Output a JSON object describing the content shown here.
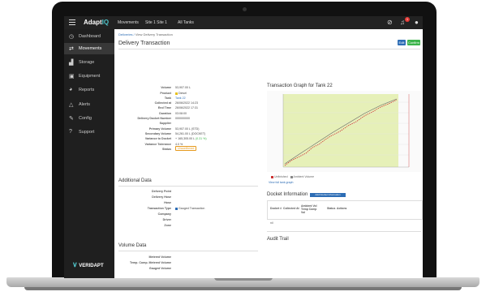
{
  "topbar": {
    "brand_main": "Adapt",
    "brand_accent": "IQ",
    "nav": [
      "Movements",
      "Site 1 Site 1",
      "All Tanks"
    ]
  },
  "sidebar": {
    "items": [
      {
        "label": "Dashboard",
        "icon": "clock-icon"
      },
      {
        "label": "Movements",
        "icon": "arrows-icon"
      },
      {
        "label": "Storage",
        "icon": "tank-icon"
      },
      {
        "label": "Equipment",
        "icon": "truck-icon"
      },
      {
        "label": "Reports",
        "icon": "chart-icon"
      },
      {
        "label": "Alerts",
        "icon": "bell-icon"
      },
      {
        "label": "Config",
        "icon": "wrench-icon"
      },
      {
        "label": "Support",
        "icon": "question-icon"
      }
    ],
    "footer_logo": "VERIDAPT"
  },
  "breadcrumb": {
    "root": "Deliveries",
    "current": "View Delivery Transaction"
  },
  "page": {
    "title": "Delivery Transaction",
    "edit_label": "Edit",
    "confirm_label": "Confirm"
  },
  "fields": [
    {
      "label": "Volume",
      "value": "53,907.00 L"
    },
    {
      "label": "Product",
      "value": "Diesel"
    },
    {
      "label": "Tank",
      "value": "Tank 22"
    },
    {
      "label": "Collected at",
      "value": "26/06/2022 14:23"
    },
    {
      "label": "End Time",
      "value": "26/06/2022 17:31"
    },
    {
      "label": "Duration",
      "value": "03:08:00"
    },
    {
      "label": "Delivery Docket Number",
      "value": "000000000"
    },
    {
      "label": "Supplier",
      "value": ""
    },
    {
      "label": "Primary Volume",
      "value": "53,907.00 L (STD)"
    },
    {
      "label": "Secondary Volume",
      "value": "54,261.00 L (DOCKET)"
    },
    {
      "label": "Variance to Docket",
      "value": "+ 165,305.00 L",
      "extra": "(0.31 %)"
    },
    {
      "label": "Variance Tolerance",
      "value": "4.0 %"
    },
    {
      "label": "Status",
      "value": "Unconfirmed"
    }
  ],
  "additional": {
    "title": "Additional Data",
    "fields": [
      {
        "label": "Delivery Point",
        "value": ""
      },
      {
        "label": "Delivery Hose",
        "value": ""
      },
      {
        "label": "Hose",
        "value": ""
      },
      {
        "label": "Transaction Type",
        "value": "Gauged Transaction"
      },
      {
        "label": "Company",
        "value": ""
      },
      {
        "label": "Driver",
        "value": ""
      },
      {
        "label": "Zone",
        "value": ""
      }
    ]
  },
  "volume_data": {
    "title": "Volume Data",
    "fields": [
      {
        "label": "Metered Volume",
        "value": ""
      },
      {
        "label": "Temp. Comp. Metered Volume",
        "value": ""
      },
      {
        "label": "Gauged Volume",
        "value": ""
      }
    ]
  },
  "graph": {
    "title": "Transaction Graph for Tank 22",
    "legend": [
      "Unfinished",
      "Ambient Volume"
    ],
    "view_link": "View full tank graph",
    "colors": {
      "band": "#e6f0b8",
      "line": "#cc3333",
      "trend": "#666666"
    }
  },
  "docket": {
    "title": "Docket Information",
    "add_label": "Add Docket Information",
    "columns": [
      "Docket #",
      "Collected At",
      "Ambient Vol Temp Comp Vol",
      "Status",
      "Actions"
    ],
    "empty": "nil"
  },
  "audit": {
    "title": "Audit Trail"
  }
}
